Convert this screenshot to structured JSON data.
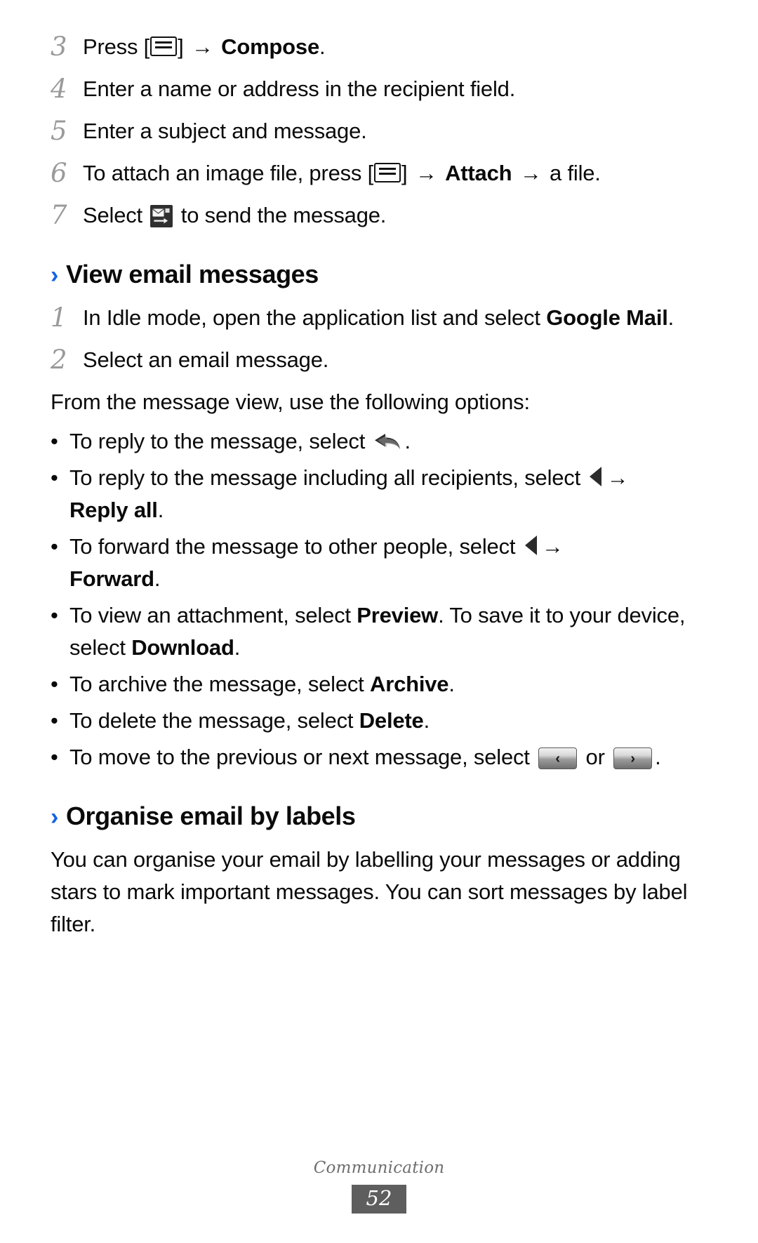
{
  "document": {
    "chapter": "Communication",
    "page_number": "52",
    "accent_color": "#1362e3",
    "footer_box_color": "#5e5e5e"
  },
  "steps_top": [
    {
      "num": "3",
      "pre": "Press [",
      "post_key": "] ",
      "arrow": "→",
      "bold": "Compose",
      "tail": "."
    },
    {
      "num": "4",
      "text": "Enter a name or address in the recipient field."
    },
    {
      "num": "5",
      "text": "Enter a subject and message."
    },
    {
      "num": "6",
      "pre": "To attach an image file, press [",
      "post_key": "] ",
      "arrow": "→",
      "bold": "Attach",
      "arrow2": "→",
      "tail": " a file."
    },
    {
      "num": "7",
      "pre": "Select ",
      "tail": " to send the message."
    }
  ],
  "section_view": {
    "chevron": "›",
    "title": "View email messages",
    "steps": [
      {
        "num": "1",
        "pre": "In Idle mode, open the application list and select ",
        "bold": "Google Mail",
        "tail": "."
      },
      {
        "num": "2",
        "text": "Select an email message."
      }
    ],
    "intro": "From the message view, use the following options:",
    "bullet_marker": "•",
    "bullets": [
      {
        "pre": "To reply to the message, select ",
        "icon": "reply-icon",
        "tail": "."
      },
      {
        "pre": "To reply to the message including all recipients, select ",
        "icon": "triangle-left-icon",
        "arrow": "→",
        "bold": "Reply all",
        "tail": "."
      },
      {
        "pre": "To forward the message to other people, select ",
        "icon": "triangle-left-icon",
        "arrow": "→",
        "bold": "Forward",
        "tail": "."
      },
      {
        "pre": "To view an attachment, select ",
        "bold": "Preview",
        "mid": ". To save it to your device, select ",
        "bold2": "Download",
        "tail": "."
      },
      {
        "pre": "To archive the message, select ",
        "bold": "Archive",
        "tail": "."
      },
      {
        "pre": "To delete the message, select ",
        "bold": "Delete",
        "tail": "."
      },
      {
        "pre": "To move to the previous or next message, select ",
        "btn_prev": "‹",
        "between": " or ",
        "btn_next": "›",
        "tail": "."
      }
    ]
  },
  "section_organise": {
    "chevron": "›",
    "title": "Organise email by labels",
    "paragraph": "You can organise your email by labelling your messages or adding stars to mark important messages. You can sort messages by label filter."
  }
}
